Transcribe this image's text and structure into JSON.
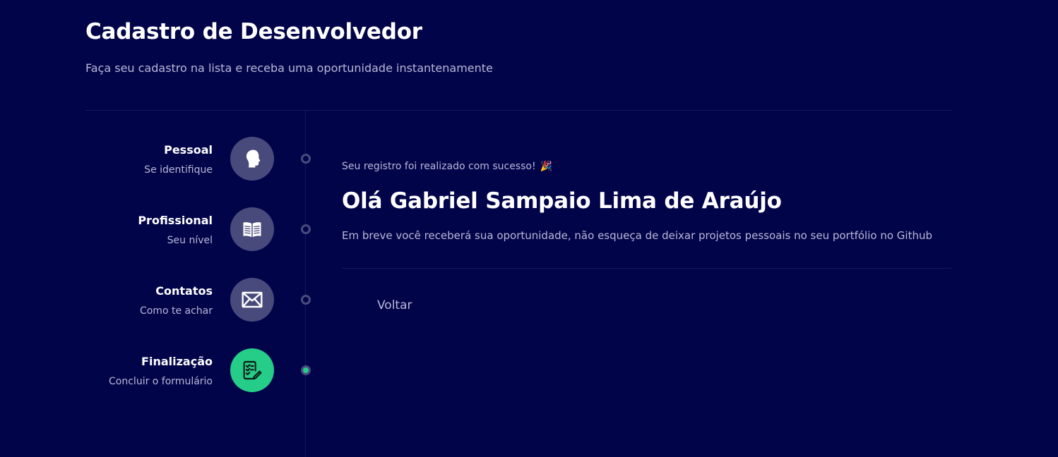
{
  "header": {
    "title": "Cadastro de Desenvolvedor",
    "subtitle": "Faça seu cadastro na lista e receba uma oportunidade instantenamente"
  },
  "steps": [
    {
      "title": "Pessoal",
      "description": "Se identifique",
      "icon": "person-head-icon",
      "active": false
    },
    {
      "title": "Profissional",
      "description": "Seu nível",
      "icon": "book-icon",
      "active": false
    },
    {
      "title": "Contatos",
      "description": "Como te achar",
      "icon": "mail-icon",
      "active": false
    },
    {
      "title": "Finalização",
      "description": "Concluir o formulário",
      "icon": "checklist-icon",
      "active": true
    }
  ],
  "content": {
    "success_message": "Seu registro foi realizado com sucesso!",
    "success_emoji": "🎉",
    "greeting": "Olá Gabriel Sampaio Lima de Araújo",
    "message": "Em breve você receberá sua oportunidade, não esqueça de deixar projetos pessoais no seu portfólio no Github",
    "back_label": "Voltar"
  },
  "colors": {
    "background": "#02044a",
    "step_inactive": "#494a7c",
    "step_active": "#25cd89",
    "muted_text": "#b8b8d6",
    "divider": "#16195c"
  }
}
